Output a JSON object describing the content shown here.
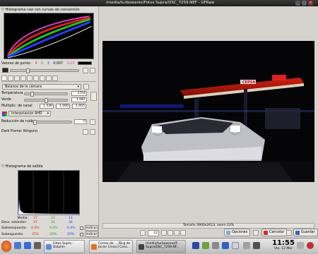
{
  "window": {
    "title": "/media/turbowarez/Fotos Supra/DSC_7259.NEF - UFRaw"
  },
  "left": {
    "raw_histogram_title": "Histograma raw con curvas de conversión",
    "valores_label": "Valores de punto:",
    "valores": [
      "4",
      "0",
      "3",
      "0.007",
      "0.23"
    ],
    "balance_combo": "Balance de la cámara",
    "temperatura_label": "Temperatura",
    "temperatura_value": "3704",
    "verde_label": "Verde",
    "verde_value": "1.081",
    "multiplic_label": "Multiplic. de canal",
    "multiplic_values": [
      "1.430",
      "1.000",
      "1.955"
    ],
    "interp_combo": "Interpolación AHD",
    "ruido_label": "Reducción de ruido",
    "ruido_value": "0",
    "darkframe_label": "Dark Frame:",
    "darkframe_value": "Ninguno",
    "output_histogram_title": "Histograma de salida",
    "stats_headers": [
      "Media:",
      "Desv. estándar:",
      "Sobreexpuesto:",
      "Subexpuesto:"
    ],
    "stats": {
      "media": [
        "17",
        "23",
        "14"
      ],
      "desv": [
        "37",
        "31",
        "34"
      ],
      "sobre": [
        "0.4%",
        "0.4%",
        "0.4%"
      ],
      "sub": [
        "25%",
        "20%",
        "29%"
      ]
    },
    "indicar_label": "Indicar"
  },
  "preview": {
    "status": "Tamaño 3900x2613, zoom 22%",
    "zoom_value": "22",
    "canopy_sign": "CEPSA"
  },
  "actions": {
    "opciones": "Opciones",
    "cancelar": "Cancelar",
    "guardar": "Guardar"
  },
  "taskbar": {
    "tasks": [
      "Fotos Supra - Dolphin",
      "Correo de ... [Bcg de Javier Ciniso] Cons...",
      "/media/turbowarez/F... Supra/DSC_7259.NF..."
    ],
    "time": "11:55",
    "date": "Vie, 12 Mar"
  },
  "colors": {
    "red": "#e02020",
    "green": "#20c020",
    "blue": "#2040ff",
    "magenta": "#d040c0",
    "accent": "#3a6ad4"
  }
}
